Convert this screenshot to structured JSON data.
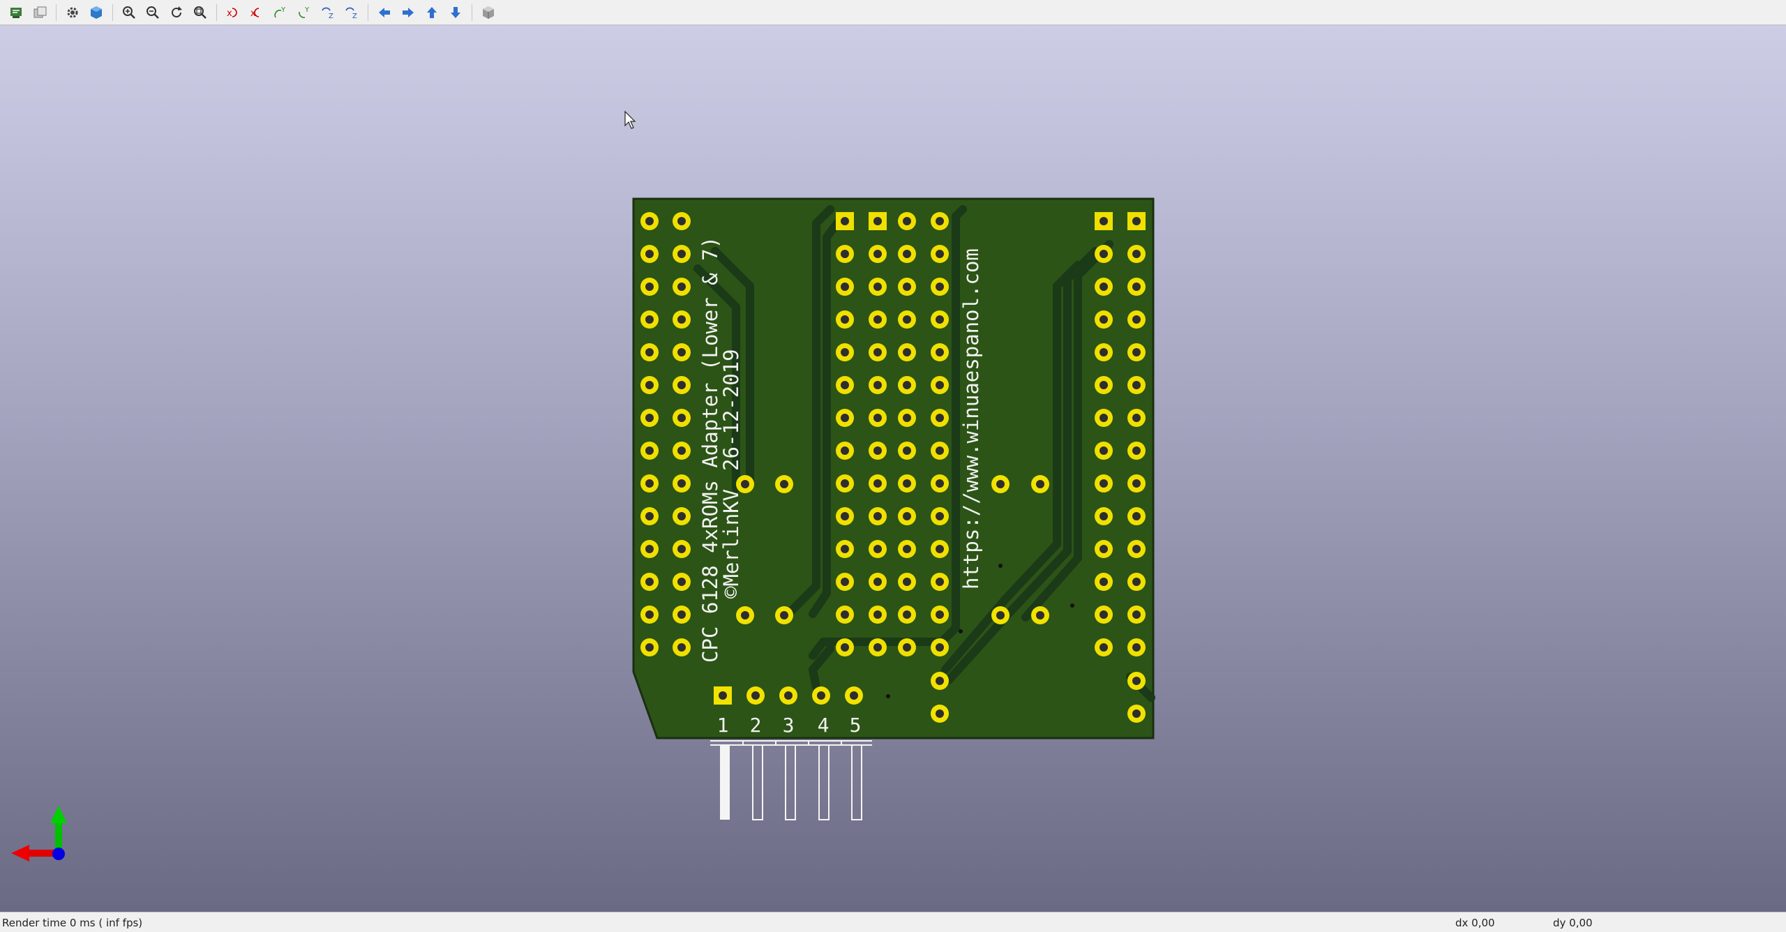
{
  "toolbar": {
    "groups": [
      [
        {
          "name": "reload-board-button",
          "icon": "reload-board-icon"
        },
        {
          "name": "copy-3d-image-button",
          "icon": "copy-image-icon"
        }
      ],
      [
        {
          "name": "display-options-button",
          "icon": "gear-icon"
        },
        {
          "name": "raytracing-toggle-button",
          "icon": "cube-render-icon"
        }
      ],
      [
        {
          "name": "zoom-in-button",
          "icon": "zoom-in-icon"
        },
        {
          "name": "zoom-out-button",
          "icon": "zoom-out-icon"
        },
        {
          "name": "redraw-button",
          "icon": "refresh-icon"
        },
        {
          "name": "zoom-fit-button",
          "icon": "zoom-fit-icon"
        }
      ],
      [
        {
          "name": "rotate-x-cw-button",
          "icon": "rotate-x-cw-icon"
        },
        {
          "name": "rotate-x-ccw-button",
          "icon": "rotate-x-ccw-icon"
        },
        {
          "name": "rotate-y-cw-button",
          "icon": "rotate-y-cw-icon"
        },
        {
          "name": "rotate-y-ccw-button",
          "icon": "rotate-y-ccw-icon"
        },
        {
          "name": "rotate-z-cw-button",
          "icon": "rotate-z-cw-icon"
        },
        {
          "name": "rotate-z-ccw-button",
          "icon": "rotate-z-ccw-icon"
        }
      ],
      [
        {
          "name": "move-left-button",
          "icon": "arrow-left-icon"
        },
        {
          "name": "move-right-button",
          "icon": "arrow-right-icon"
        },
        {
          "name": "move-up-button",
          "icon": "arrow-up-icon"
        },
        {
          "name": "move-down-button",
          "icon": "arrow-down-icon"
        }
      ],
      [
        {
          "name": "ortho-perspective-button",
          "icon": "ortho-cube-icon"
        }
      ]
    ]
  },
  "pcb": {
    "title_line": "CPC 6128 4xROMs Adapter (Lower & 7)",
    "date_line": "26-12-2019",
    "author_line": "©MerlinKV",
    "url_line": "https://www.winuaespanol.com",
    "pin_labels": [
      "1",
      "2",
      "3",
      "4",
      "5"
    ]
  },
  "colors": {
    "board": "#2c5416",
    "copper": "#19361a",
    "pad": "#f0e000",
    "silkscreen": "#f2f2f2",
    "axis_x": "#e00000",
    "axis_y": "#00c000",
    "axis_z": "#0000e0"
  },
  "status": {
    "render_time": "Render time 0 ms ( inf fps)",
    "dx": "dx 0,00",
    "dy": "dy 0,00"
  }
}
